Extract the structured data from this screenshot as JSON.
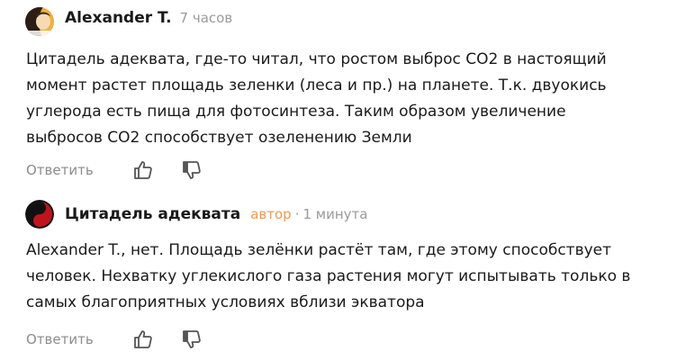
{
  "comments": [
    {
      "author": "Alexander T.",
      "time": "7 часов",
      "text": "Цитадель адеквата, где-то читал, что ростом выброс СО2 в настоящий\nмомент растет площадь зеленки (леса и пр.) на планете. Т.к. двуокись\nуглерода есть пища для фотосинтеза. Таким образом увеличение\nвыбросов СО2 способствует озеленению Земли",
      "reply_label": "Ответить",
      "avatar_icon": "user-avatar-orange"
    },
    {
      "author": "Цитадель адеквата",
      "author_tag": "автор",
      "time": "1 минута",
      "text": "Alexander T., нет. Площадь зелёнки растёт там, где этому способствует\nчеловек. Нехватку углекислого газа растения могут испытывать только в\nсамых благоприятных условиях вблизи экватора",
      "reply_label": "Ответить",
      "avatar_icon": "yin-yang-red-avatar"
    }
  ],
  "colors": {
    "author_tag": "#f2994a",
    "meta": "#9a9a9a",
    "reply": "#8c8c8c",
    "icon": "#555555"
  },
  "icons": {
    "like": "thumb-up-icon",
    "dislike": "thumb-down-icon"
  }
}
